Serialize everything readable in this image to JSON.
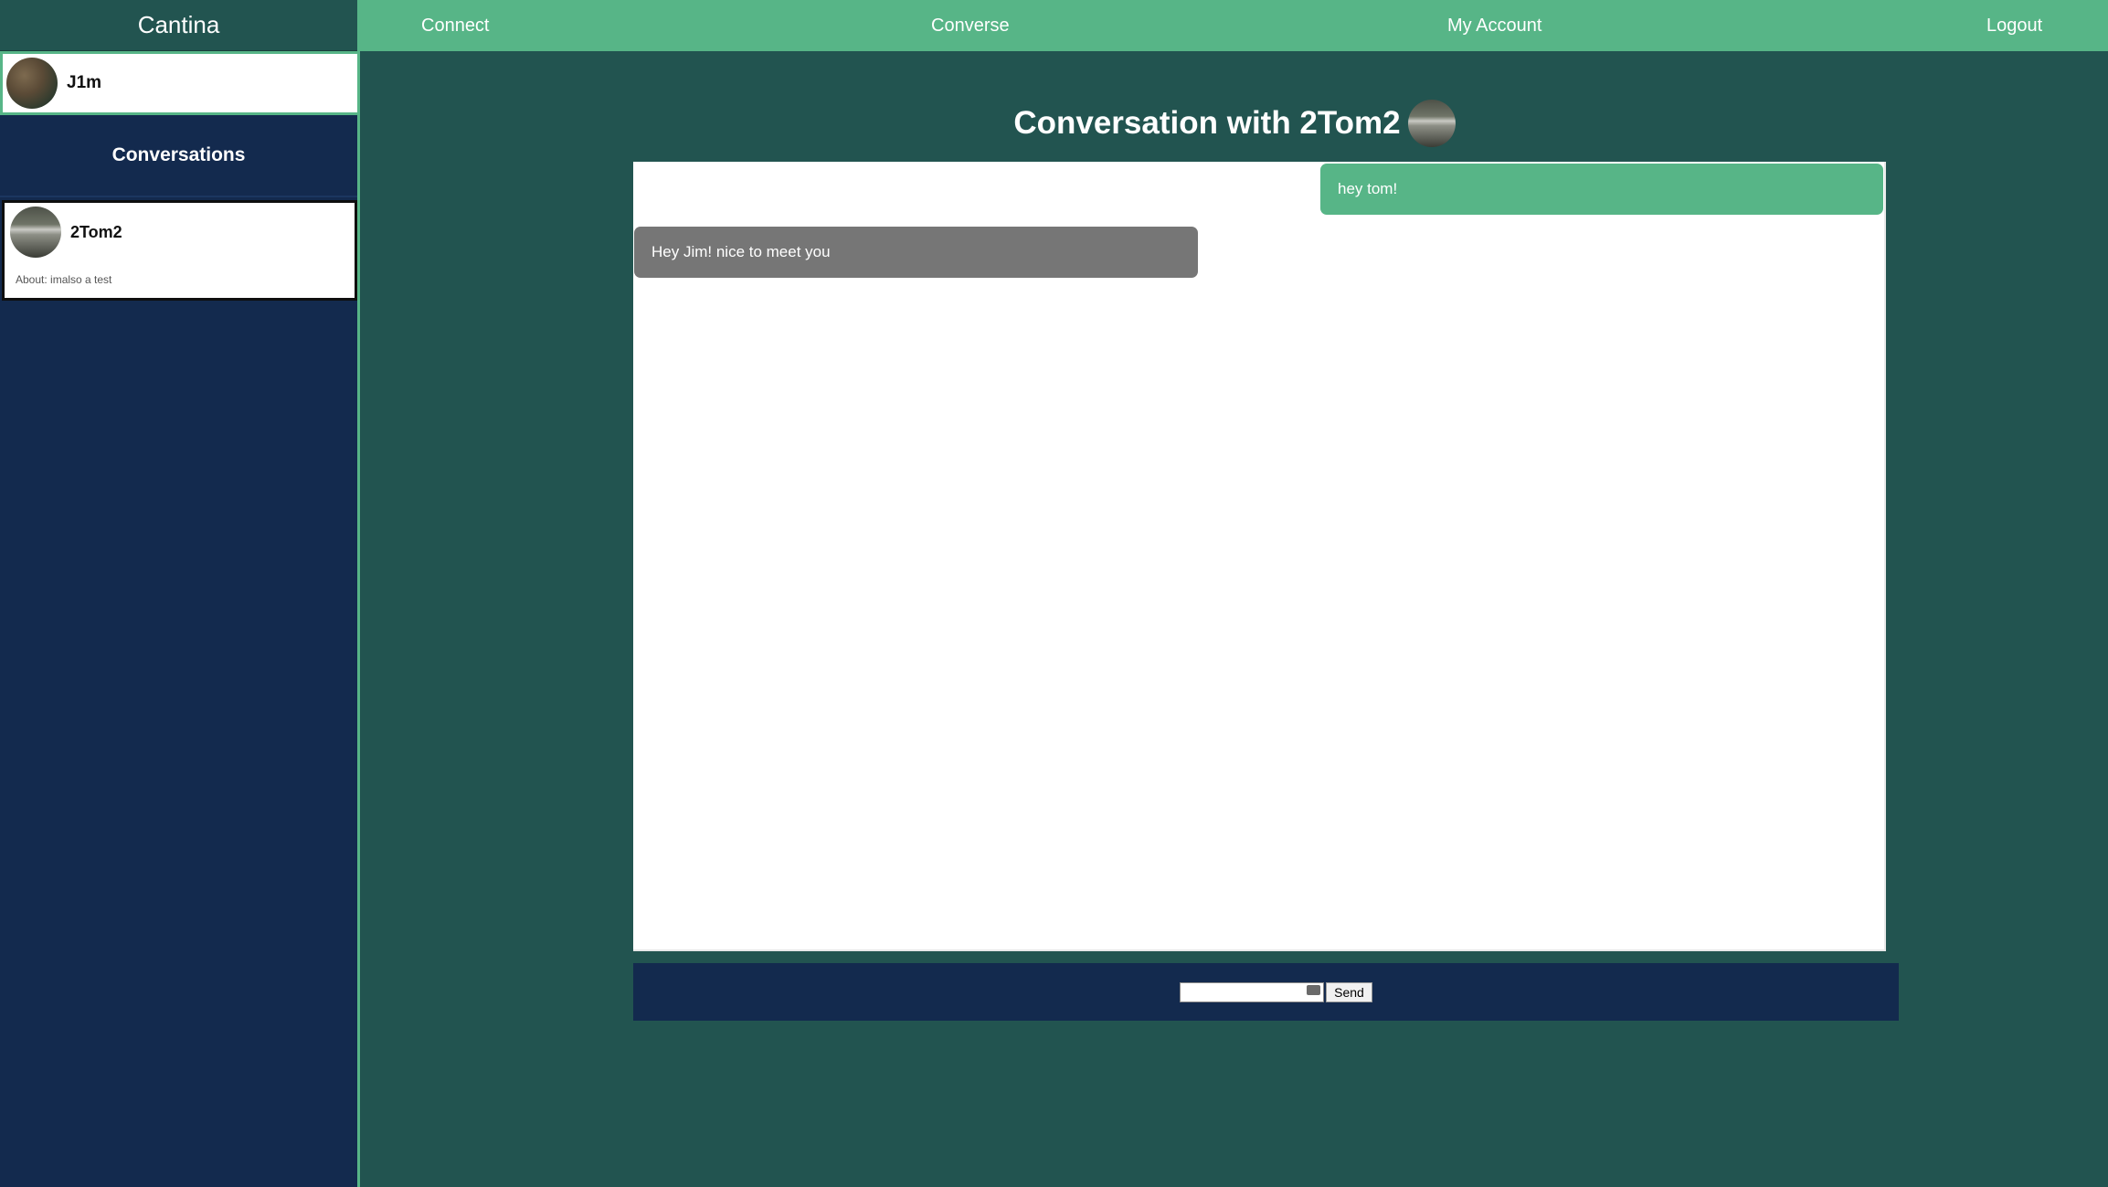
{
  "app": {
    "brand": "Cantina"
  },
  "nav": {
    "items": [
      "Connect",
      "Converse",
      "My Account",
      "Logout"
    ]
  },
  "sidebar": {
    "current_user": {
      "name": "J1m",
      "avatar_icon": "user-avatar"
    },
    "conversations_header": "Conversations",
    "conversations": [
      {
        "name": "2Tom2",
        "about": "About: imalso a test",
        "avatar_icon": "contact-avatar"
      }
    ]
  },
  "main": {
    "title": "Conversation with 2Tom2",
    "messages": [
      {
        "direction": "outgoing",
        "text": "hey tom!"
      },
      {
        "direction": "incoming",
        "text": "Hey Jim! nice to meet you"
      }
    ]
  },
  "composer": {
    "input_value": "",
    "send_label": "Send"
  },
  "colors": {
    "accent": "#57b587",
    "background": "#225450",
    "sidebar": "#132a4e",
    "incoming_bubble": "#767676"
  }
}
